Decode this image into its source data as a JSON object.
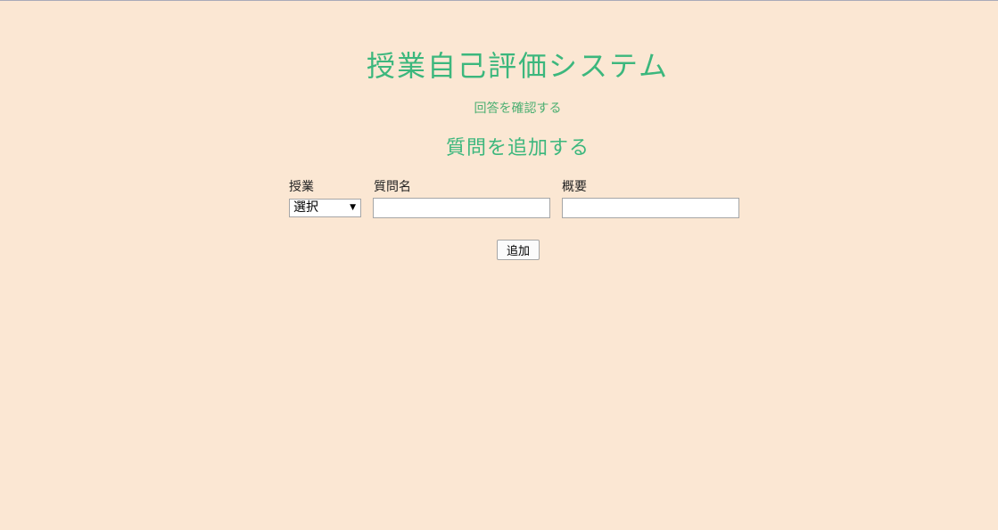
{
  "header": {
    "title": "授業自己評価システム",
    "answers_link": "回答を確認する",
    "section_title": "質問を追加する"
  },
  "form": {
    "class_label": "授業",
    "class_select_value": "選択",
    "question_name_label": "質問名",
    "question_name_value": "",
    "summary_label": "概要",
    "summary_value": "",
    "add_button_label": "追加"
  },
  "colors": {
    "background": "#fbe7d3",
    "accent_green": "#3cb77d"
  }
}
